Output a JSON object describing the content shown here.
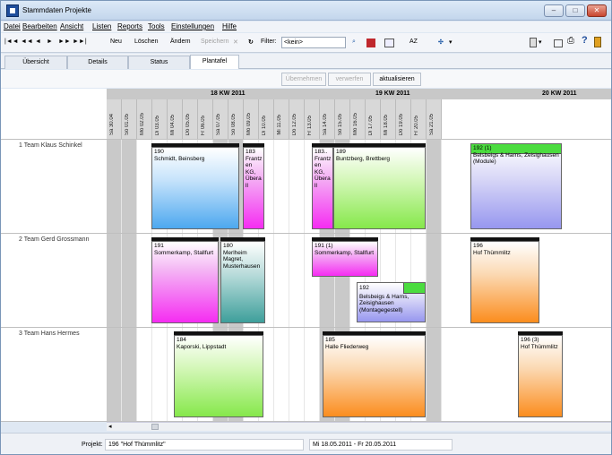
{
  "window": {
    "title": "Stammdaten Projekte",
    "minimize_icon": "minimize-icon",
    "maximize_icon": "maximize-icon",
    "close_icon": "close-icon"
  },
  "menu": [
    "Datei",
    "Bearbeiten",
    "Ansicht",
    "Listen",
    "Reports",
    "Tools",
    "Einstellungen",
    "Hilfe"
  ],
  "toolbar": {
    "nav_glyphs": [
      "|◄◄",
      "◄◄",
      "◄",
      "►",
      "►►",
      "►►|"
    ],
    "new_label": "Neu",
    "delete_label": "Löschen",
    "edit_label": "Ändern",
    "save_label": "Speichern",
    "cancel_glyph": "✕",
    "refresh_glyph": "↻",
    "filter_label": "Filter:",
    "filter_value": "<kein>",
    "sort_label": "AZ"
  },
  "tabs": [
    "Übersicht",
    "Details",
    "Status",
    "Plantafel"
  ],
  "actions": {
    "apply_label": "Übernehmen",
    "discard_label": "verwerfen",
    "refresh_label": "aktualisieren"
  },
  "weeks": [
    {
      "label": "18  KW  2011"
    },
    {
      "label": "19  KW  2011"
    },
    {
      "label": "20  KW  2011"
    }
  ],
  "days": [
    "Sa 30.04",
    "So 01.05",
    "Mo 02.05",
    "Di 03.05",
    "Mi 04.05",
    "Do 05.05",
    "Fr 06.05",
    "Sa 07.05",
    "So 08.05",
    "Mo 09.05",
    "Di 10.05",
    "Mi 11.05",
    "Do 12.05",
    "Fr 13.05",
    "Sa 14.05",
    "So 15.05",
    "Mo 16.05",
    "Di 17.05",
    "Mi 18.05",
    "Do 19.05",
    "Fr 20.05",
    "Sa 21.05"
  ],
  "teams": [
    "1 Team Klaus Schinkel",
    "2 Team Gerd Grossmann",
    "3 Team Hans Hermes"
  ],
  "blocks": {
    "b190": {
      "id": "190",
      "text": "Schmidt, Beinsberg"
    },
    "b183a": {
      "id": "183",
      "text": "Frantz en KG, Übera ll"
    },
    "b183b": {
      "id": "183..",
      "text": "Frantz en KG, Übera ll"
    },
    "b189": {
      "id": "189",
      "text": "Buntzberg, Brettberg"
    },
    "b192a": {
      "id": "192 (1)",
      "text": "Belsbeigs & Harns, Zeisighausen (Module)"
    },
    "b191a": {
      "id": "191",
      "text": "Sommerkamp, Stallfurt"
    },
    "b180": {
      "id": "180",
      "text": "Merlheim Magret, Musterhausen"
    },
    "b191b": {
      "id": "191 (1)",
      "text": "Sommerkamp, Stallfurt"
    },
    "b192b": {
      "id": "192",
      "text": "Belsbeigs & Harns, Zeisighausen (Montagegestell)"
    },
    "b196a": {
      "id": "196",
      "text": "Hof Thümmlitz"
    },
    "b184": {
      "id": "184",
      "text": "Kaporski, Lippstadt"
    },
    "b185": {
      "id": "185",
      "text": "Halle Fliederweg"
    },
    "b196b": {
      "id": "196 (3)",
      "text": "Hof Thümmlitz"
    }
  },
  "status": {
    "project_label": "Projekt:",
    "project_value": "196 \"Hof Thümmlitz\"",
    "date_range": "Mi 18.05.2011 - Fr 20.05.2011"
  },
  "colors": {
    "blue": "#4da8ef",
    "magenta": "#f52cf2",
    "green": "#86e84b",
    "teal": "#3e9f9b",
    "orange": "#fb8d1e",
    "violet": "#9797ef"
  }
}
